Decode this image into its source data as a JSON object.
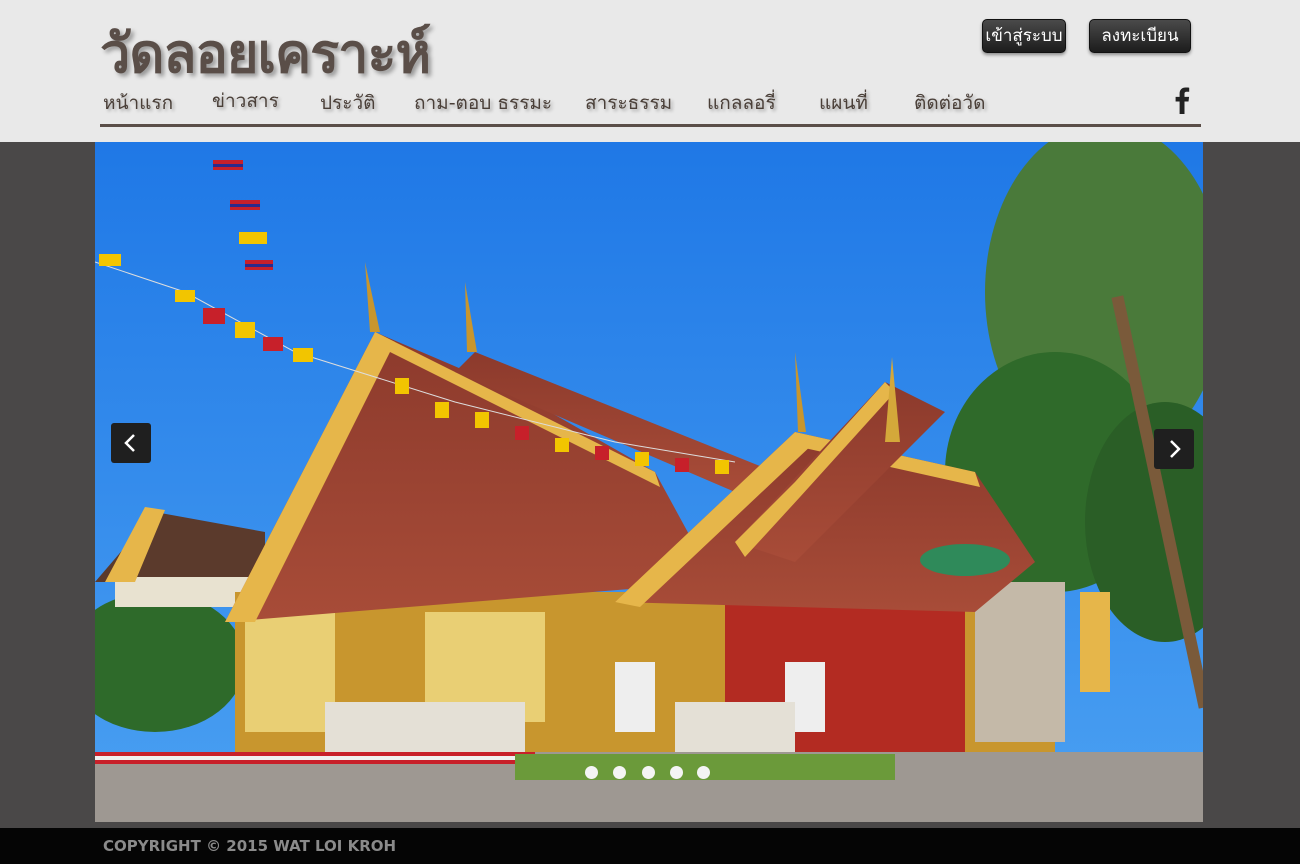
{
  "header": {
    "site_title": "วัดลอยเคราะห์",
    "login_label": "เข้าสู่ระบบ",
    "register_label": "ลงทะเบียน"
  },
  "nav": {
    "items": [
      {
        "label": "หน้าแรก"
      },
      {
        "label": "ข่าวสาร"
      },
      {
        "label": "ประวัติ"
      },
      {
        "label": "ถาม-ตอบ ธรรมะ"
      },
      {
        "label": "สาระธรรม"
      },
      {
        "label": "แกลลอรี่"
      },
      {
        "label": "แผนที่"
      },
      {
        "label": "ติดต่อวัด"
      }
    ],
    "social_icon": "facebook-icon"
  },
  "slider": {
    "image": "temple-photo",
    "prev_icon": "chevron-left-icon",
    "next_icon": "chevron-right-icon",
    "slide_count": 5
  },
  "footer": {
    "copyright": "COPYRIGHT © 2015 WAT LOI KROH"
  },
  "colors": {
    "header_bg": "#e9e9e9",
    "brand_brown": "#5a4e48",
    "page_bg": "#4a4848",
    "footer_bg": "#050505"
  }
}
